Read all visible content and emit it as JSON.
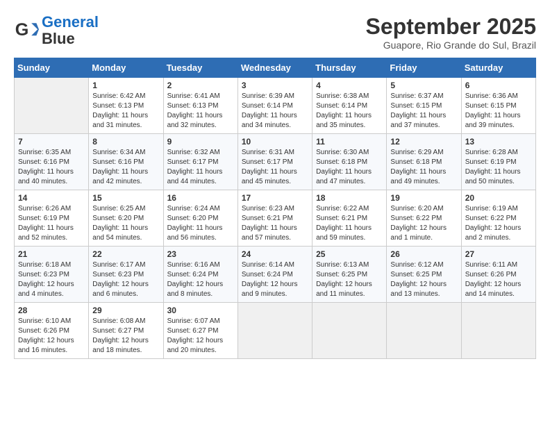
{
  "header": {
    "logo_line1": "General",
    "logo_line2": "Blue",
    "month": "September 2025",
    "location": "Guapore, Rio Grande do Sul, Brazil"
  },
  "days_of_week": [
    "Sunday",
    "Monday",
    "Tuesday",
    "Wednesday",
    "Thursday",
    "Friday",
    "Saturday"
  ],
  "weeks": [
    [
      {
        "day": "",
        "empty": true
      },
      {
        "day": "1",
        "sunrise": "Sunrise: 6:42 AM",
        "sunset": "Sunset: 6:13 PM",
        "daylight": "Daylight: 11 hours and 31 minutes."
      },
      {
        "day": "2",
        "sunrise": "Sunrise: 6:41 AM",
        "sunset": "Sunset: 6:13 PM",
        "daylight": "Daylight: 11 hours and 32 minutes."
      },
      {
        "day": "3",
        "sunrise": "Sunrise: 6:39 AM",
        "sunset": "Sunset: 6:14 PM",
        "daylight": "Daylight: 11 hours and 34 minutes."
      },
      {
        "day": "4",
        "sunrise": "Sunrise: 6:38 AM",
        "sunset": "Sunset: 6:14 PM",
        "daylight": "Daylight: 11 hours and 35 minutes."
      },
      {
        "day": "5",
        "sunrise": "Sunrise: 6:37 AM",
        "sunset": "Sunset: 6:15 PM",
        "daylight": "Daylight: 11 hours and 37 minutes."
      },
      {
        "day": "6",
        "sunrise": "Sunrise: 6:36 AM",
        "sunset": "Sunset: 6:15 PM",
        "daylight": "Daylight: 11 hours and 39 minutes."
      }
    ],
    [
      {
        "day": "7",
        "sunrise": "Sunrise: 6:35 AM",
        "sunset": "Sunset: 6:16 PM",
        "daylight": "Daylight: 11 hours and 40 minutes."
      },
      {
        "day": "8",
        "sunrise": "Sunrise: 6:34 AM",
        "sunset": "Sunset: 6:16 PM",
        "daylight": "Daylight: 11 hours and 42 minutes."
      },
      {
        "day": "9",
        "sunrise": "Sunrise: 6:32 AM",
        "sunset": "Sunset: 6:17 PM",
        "daylight": "Daylight: 11 hours and 44 minutes."
      },
      {
        "day": "10",
        "sunrise": "Sunrise: 6:31 AM",
        "sunset": "Sunset: 6:17 PM",
        "daylight": "Daylight: 11 hours and 45 minutes."
      },
      {
        "day": "11",
        "sunrise": "Sunrise: 6:30 AM",
        "sunset": "Sunset: 6:18 PM",
        "daylight": "Daylight: 11 hours and 47 minutes."
      },
      {
        "day": "12",
        "sunrise": "Sunrise: 6:29 AM",
        "sunset": "Sunset: 6:18 PM",
        "daylight": "Daylight: 11 hours and 49 minutes."
      },
      {
        "day": "13",
        "sunrise": "Sunrise: 6:28 AM",
        "sunset": "Sunset: 6:19 PM",
        "daylight": "Daylight: 11 hours and 50 minutes."
      }
    ],
    [
      {
        "day": "14",
        "sunrise": "Sunrise: 6:26 AM",
        "sunset": "Sunset: 6:19 PM",
        "daylight": "Daylight: 11 hours and 52 minutes."
      },
      {
        "day": "15",
        "sunrise": "Sunrise: 6:25 AM",
        "sunset": "Sunset: 6:20 PM",
        "daylight": "Daylight: 11 hours and 54 minutes."
      },
      {
        "day": "16",
        "sunrise": "Sunrise: 6:24 AM",
        "sunset": "Sunset: 6:20 PM",
        "daylight": "Daylight: 11 hours and 56 minutes."
      },
      {
        "day": "17",
        "sunrise": "Sunrise: 6:23 AM",
        "sunset": "Sunset: 6:21 PM",
        "daylight": "Daylight: 11 hours and 57 minutes."
      },
      {
        "day": "18",
        "sunrise": "Sunrise: 6:22 AM",
        "sunset": "Sunset: 6:21 PM",
        "daylight": "Daylight: 11 hours and 59 minutes."
      },
      {
        "day": "19",
        "sunrise": "Sunrise: 6:20 AM",
        "sunset": "Sunset: 6:22 PM",
        "daylight": "Daylight: 12 hours and 1 minute."
      },
      {
        "day": "20",
        "sunrise": "Sunrise: 6:19 AM",
        "sunset": "Sunset: 6:22 PM",
        "daylight": "Daylight: 12 hours and 2 minutes."
      }
    ],
    [
      {
        "day": "21",
        "sunrise": "Sunrise: 6:18 AM",
        "sunset": "Sunset: 6:23 PM",
        "daylight": "Daylight: 12 hours and 4 minutes."
      },
      {
        "day": "22",
        "sunrise": "Sunrise: 6:17 AM",
        "sunset": "Sunset: 6:23 PM",
        "daylight": "Daylight: 12 hours and 6 minutes."
      },
      {
        "day": "23",
        "sunrise": "Sunrise: 6:16 AM",
        "sunset": "Sunset: 6:24 PM",
        "daylight": "Daylight: 12 hours and 8 minutes."
      },
      {
        "day": "24",
        "sunrise": "Sunrise: 6:14 AM",
        "sunset": "Sunset: 6:24 PM",
        "daylight": "Daylight: 12 hours and 9 minutes."
      },
      {
        "day": "25",
        "sunrise": "Sunrise: 6:13 AM",
        "sunset": "Sunset: 6:25 PM",
        "daylight": "Daylight: 12 hours and 11 minutes."
      },
      {
        "day": "26",
        "sunrise": "Sunrise: 6:12 AM",
        "sunset": "Sunset: 6:25 PM",
        "daylight": "Daylight: 12 hours and 13 minutes."
      },
      {
        "day": "27",
        "sunrise": "Sunrise: 6:11 AM",
        "sunset": "Sunset: 6:26 PM",
        "daylight": "Daylight: 12 hours and 14 minutes."
      }
    ],
    [
      {
        "day": "28",
        "sunrise": "Sunrise: 6:10 AM",
        "sunset": "Sunset: 6:26 PM",
        "daylight": "Daylight: 12 hours and 16 minutes."
      },
      {
        "day": "29",
        "sunrise": "Sunrise: 6:08 AM",
        "sunset": "Sunset: 6:27 PM",
        "daylight": "Daylight: 12 hours and 18 minutes."
      },
      {
        "day": "30",
        "sunrise": "Sunrise: 6:07 AM",
        "sunset": "Sunset: 6:27 PM",
        "daylight": "Daylight: 12 hours and 20 minutes."
      },
      {
        "day": "",
        "empty": true
      },
      {
        "day": "",
        "empty": true
      },
      {
        "day": "",
        "empty": true
      },
      {
        "day": "",
        "empty": true
      }
    ]
  ]
}
